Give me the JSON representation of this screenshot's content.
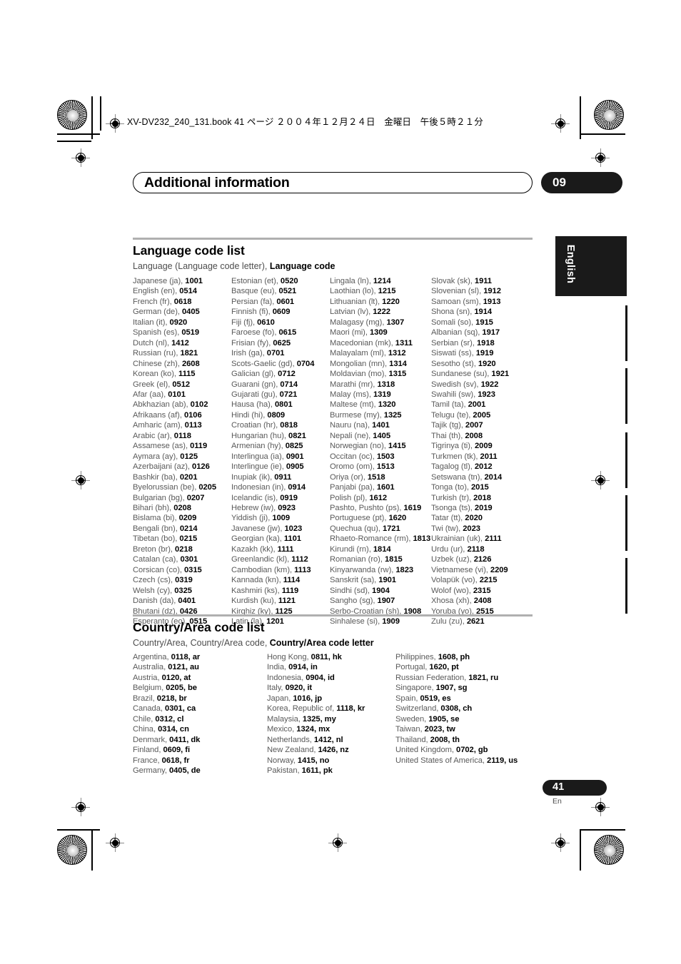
{
  "header": {
    "file_line": "XV-DV232_240_131.book  41 ページ  ２００４年１２月２４日　金曜日　午後５時２１分"
  },
  "chapter": {
    "title": "Additional information",
    "number": "09"
  },
  "side_tab": {
    "label": "English"
  },
  "footer": {
    "page_number": "41",
    "language_mark": "En"
  },
  "language_section": {
    "title": "Language code list",
    "subtitle_plain": "Language (Language code letter), ",
    "subtitle_bold": "Language code",
    "columns": [
      [
        {
          "name": "Japanese (ja), ",
          "code": "1001"
        },
        {
          "name": "English (en), ",
          "code": "0514"
        },
        {
          "name": "French (fr), ",
          "code": "0618"
        },
        {
          "name": "German (de), ",
          "code": "0405"
        },
        {
          "name": "Italian (it), ",
          "code": "0920"
        },
        {
          "name": "Spanish (es), ",
          "code": "0519"
        },
        {
          "name": "Dutch (nl), ",
          "code": "1412"
        },
        {
          "name": "Russian (ru), ",
          "code": "1821"
        },
        {
          "name": "Chinese (zh), ",
          "code": "2608"
        },
        {
          "name": "Korean (ko), ",
          "code": "1115"
        },
        {
          "name": "Greek (el), ",
          "code": "0512"
        },
        {
          "name": "Afar (aa), ",
          "code": "0101"
        },
        {
          "name": "Abkhazian (ab), ",
          "code": "0102"
        },
        {
          "name": "Afrikaans (af), ",
          "code": "0106"
        },
        {
          "name": "Amharic (am), ",
          "code": "0113"
        },
        {
          "name": "Arabic (ar), ",
          "code": "0118"
        },
        {
          "name": "Assamese (as), ",
          "code": "0119"
        },
        {
          "name": "Aymara (ay), ",
          "code": "0125"
        },
        {
          "name": "Azerbaijani (az), ",
          "code": "0126"
        },
        {
          "name": "Bashkir (ba), ",
          "code": "0201"
        },
        {
          "name": "Byelorussian (be), ",
          "code": "0205"
        },
        {
          "name": "Bulgarian (bg), ",
          "code": "0207"
        },
        {
          "name": "Bihari (bh), ",
          "code": "0208"
        },
        {
          "name": "Bislama (bi), ",
          "code": "0209"
        },
        {
          "name": "Bengali (bn), ",
          "code": "0214"
        },
        {
          "name": "Tibetan (bo), ",
          "code": "0215"
        },
        {
          "name": "Breton (br), ",
          "code": "0218"
        },
        {
          "name": "Catalan (ca), ",
          "code": "0301"
        },
        {
          "name": "Corsican (co), ",
          "code": "0315"
        },
        {
          "name": "Czech (cs), ",
          "code": "0319"
        },
        {
          "name": "Welsh (cy), ",
          "code": "0325"
        },
        {
          "name": "Danish (da), ",
          "code": "0401"
        },
        {
          "name": "Bhutani (dz), ",
          "code": "0426"
        },
        {
          "name": "Esperanto (eo), ",
          "code": "0515"
        }
      ],
      [
        {
          "name": "Estonian (et), ",
          "code": "0520"
        },
        {
          "name": "Basque (eu), ",
          "code": "0521"
        },
        {
          "name": "Persian (fa), ",
          "code": "0601"
        },
        {
          "name": "Finnish (fi), ",
          "code": "0609"
        },
        {
          "name": "Fiji (fj), ",
          "code": "0610"
        },
        {
          "name": "Faroese (fo), ",
          "code": "0615"
        },
        {
          "name": "Frisian (fy), ",
          "code": "0625"
        },
        {
          "name": "Irish (ga), ",
          "code": "0701"
        },
        {
          "name": "Scots-Gaelic (gd), ",
          "code": "0704"
        },
        {
          "name": "Galician (gl), ",
          "code": "0712"
        },
        {
          "name": "Guarani (gn), ",
          "code": "0714"
        },
        {
          "name": "Gujarati (gu), ",
          "code": "0721"
        },
        {
          "name": "Hausa (ha), ",
          "code": "0801"
        },
        {
          "name": "Hindi (hi), ",
          "code": "0809"
        },
        {
          "name": "Croatian (hr), ",
          "code": "0818"
        },
        {
          "name": "Hungarian (hu), ",
          "code": "0821"
        },
        {
          "name": "Armenian (hy), ",
          "code": "0825"
        },
        {
          "name": "Interlingua (ia), ",
          "code": "0901"
        },
        {
          "name": "Interlingue (ie), ",
          "code": "0905"
        },
        {
          "name": "Inupiak (ik), ",
          "code": "0911"
        },
        {
          "name": "Indonesian (in), ",
          "code": "0914"
        },
        {
          "name": "Icelandic (is), ",
          "code": "0919"
        },
        {
          "name": "Hebrew (iw), ",
          "code": "0923"
        },
        {
          "name": "Yiddish (ji), ",
          "code": "1009"
        },
        {
          "name": "Javanese (jw), ",
          "code": "1023"
        },
        {
          "name": "Georgian (ka), ",
          "code": "1101"
        },
        {
          "name": "Kazakh (kk), ",
          "code": "1111"
        },
        {
          "name": "Greenlandic  (kl), ",
          "code": "1112"
        },
        {
          "name": "Cambodian (km), ",
          "code": "1113"
        },
        {
          "name": "Kannada (kn), ",
          "code": "1114"
        },
        {
          "name": "Kashmiri (ks), ",
          "code": "1119"
        },
        {
          "name": "Kurdish (ku), ",
          "code": "1121"
        },
        {
          "name": "Kirghiz (ky), ",
          "code": "1125"
        },
        {
          "name": "Latin (la), ",
          "code": "1201"
        }
      ],
      [
        {
          "name": "Lingala (ln), ",
          "code": "1214"
        },
        {
          "name": "Laothian (lo), ",
          "code": "1215"
        },
        {
          "name": "Lithuanian (lt), ",
          "code": "1220"
        },
        {
          "name": "Latvian (lv), ",
          "code": "1222"
        },
        {
          "name": "Malagasy (mg), ",
          "code": "1307"
        },
        {
          "name": "Maori (mi), ",
          "code": "1309"
        },
        {
          "name": "Macedonian (mk), ",
          "code": "1311"
        },
        {
          "name": "Malayalam  (ml), ",
          "code": "1312"
        },
        {
          "name": "Mongolian (mn), ",
          "code": "1314"
        },
        {
          "name": "Moldavian (mo), ",
          "code": "1315"
        },
        {
          "name": "Marathi (mr), ",
          "code": "1318"
        },
        {
          "name": "Malay  (ms), ",
          "code": "1319"
        },
        {
          "name": "Maltese (mt), ",
          "code": "1320"
        },
        {
          "name": "Burmese (my), ",
          "code": "1325"
        },
        {
          "name": "Nauru (na), ",
          "code": "1401"
        },
        {
          "name": "Nepali (ne), ",
          "code": "1405"
        },
        {
          "name": "Norwegian (no), ",
          "code": "1415"
        },
        {
          "name": "Occitan (oc), ",
          "code": "1503"
        },
        {
          "name": "Oromo (om), ",
          "code": "1513"
        },
        {
          "name": "Oriya (or), ",
          "code": "1518"
        },
        {
          "name": "Panjabi (pa), ",
          "code": "1601"
        },
        {
          "name": "Polish (pl), ",
          "code": "1612"
        },
        {
          "name": "Pashto, Pushto (ps), ",
          "code": "1619"
        },
        {
          "name": "Portuguese (pt), ",
          "code": "1620"
        },
        {
          "name": "Quechua (qu), ",
          "code": "1721"
        },
        {
          "name": "Rhaeto-Romance (rm), ",
          "code": "1813"
        },
        {
          "name": "Kirundi (rn), ",
          "code": "1814"
        },
        {
          "name": "Romanian (ro), ",
          "code": "1815"
        },
        {
          "name": "Kinyarwanda (rw), ",
          "code": "1823"
        },
        {
          "name": "Sanskrit (sa), ",
          "code": "1901"
        },
        {
          "name": "Sindhi (sd), ",
          "code": "1904"
        },
        {
          "name": "Sangho (sg), ",
          "code": "1907"
        },
        {
          "name": "Serbo-Croatian (sh), ",
          "code": "1908"
        },
        {
          "name": "Sinhalese (si), ",
          "code": "1909"
        }
      ],
      [
        {
          "name": "Slovak (sk), ",
          "code": "1911"
        },
        {
          "name": "Slovenian (sl), ",
          "code": "1912"
        },
        {
          "name": "Samoan (sm), ",
          "code": "1913"
        },
        {
          "name": "Shona (sn), ",
          "code": "1914"
        },
        {
          "name": "Somali (so), ",
          "code": "1915"
        },
        {
          "name": "Albanian (sq), ",
          "code": "1917"
        },
        {
          "name": "Serbian (sr), ",
          "code": "1918"
        },
        {
          "name": "Siswati (ss), ",
          "code": "1919"
        },
        {
          "name": "Sesotho (st), ",
          "code": "1920"
        },
        {
          "name": "Sundanese (su), ",
          "code": "1921"
        },
        {
          "name": "Swedish (sv), ",
          "code": "1922"
        },
        {
          "name": "Swahili (sw), ",
          "code": "1923"
        },
        {
          "name": "Tamil (ta), ",
          "code": "2001"
        },
        {
          "name": "Telugu (te), ",
          "code": "2005"
        },
        {
          "name": "Tajik (tg), ",
          "code": "2007"
        },
        {
          "name": "Thai (th), ",
          "code": "2008"
        },
        {
          "name": "Tigrinya (ti), ",
          "code": "2009"
        },
        {
          "name": "Turkmen (tk), ",
          "code": "2011"
        },
        {
          "name": "Tagalog (tl), ",
          "code": "2012"
        },
        {
          "name": "Setswana (tn), ",
          "code": "2014"
        },
        {
          "name": "Tonga (to), ",
          "code": "2015"
        },
        {
          "name": "Turkish (tr), ",
          "code": "2018"
        },
        {
          "name": "Tsonga (ts), ",
          "code": "2019"
        },
        {
          "name": "Tatar (tt), ",
          "code": "2020"
        },
        {
          "name": "Twi (tw), ",
          "code": "2023"
        },
        {
          "name": "Ukrainian (uk), ",
          "code": "2111"
        },
        {
          "name": "Urdu (ur), ",
          "code": "2118"
        },
        {
          "name": "Uzbek (uz), ",
          "code": "2126"
        },
        {
          "name": "Vietnamese (vi), ",
          "code": "2209"
        },
        {
          "name": "Volapük (vo), ",
          "code": "2215"
        },
        {
          "name": "Wolof (wo), ",
          "code": "2315"
        },
        {
          "name": "Xhosa (xh), ",
          "code": "2408"
        },
        {
          "name": "Yoruba (yo), ",
          "code": "2515"
        },
        {
          "name": "Zulu (zu), ",
          "code": "2621"
        }
      ]
    ]
  },
  "country_section": {
    "title": "Country/Area code list",
    "subtitle_plain": "Country/Area, Country/Area code, ",
    "subtitle_bold": "Country/Area code letter",
    "columns": [
      [
        {
          "name": "Argentina, ",
          "code": "0118, ar"
        },
        {
          "name": "Australia, ",
          "code": "0121, au"
        },
        {
          "name": "Austria, ",
          "code": "0120, at"
        },
        {
          "name": "Belgium, ",
          "code": "0205, be"
        },
        {
          "name": "Brazil, ",
          "code": "0218, br"
        },
        {
          "name": "Canada, ",
          "code": "0301, ca"
        },
        {
          "name": "Chile, ",
          "code": "0312, cl"
        },
        {
          "name": "China, ",
          "code": "0314, cn"
        },
        {
          "name": "Denmark, ",
          "code": "0411, dk"
        },
        {
          "name": "Finland, ",
          "code": "0609, fi"
        },
        {
          "name": "France, ",
          "code": "0618, fr"
        },
        {
          "name": "Germany, ",
          "code": "0405, de"
        }
      ],
      [
        {
          "name": "Hong Kong, ",
          "code": "0811, hk"
        },
        {
          "name": "India, ",
          "code": "0914, in"
        },
        {
          "name": "Indonesia, ",
          "code": "0904, id"
        },
        {
          "name": "Italy, ",
          "code": "0920, it"
        },
        {
          "name": "Japan, ",
          "code": "1016, jp"
        },
        {
          "name": "Korea, Republic of, ",
          "code": "1118, kr"
        },
        {
          "name": "Malaysia, ",
          "code": "1325, my"
        },
        {
          "name": "Mexico, ",
          "code": "1324, mx"
        },
        {
          "name": "Netherlands, ",
          "code": "1412, nl"
        },
        {
          "name": "New Zealand, ",
          "code": "1426, nz"
        },
        {
          "name": "Norway, ",
          "code": "1415, no"
        },
        {
          "name": "Pakistan, ",
          "code": "1611, pk"
        }
      ],
      [
        {
          "name": "Philippines, ",
          "code": "1608, ph"
        },
        {
          "name": "Portugal, ",
          "code": "1620, pt"
        },
        {
          "name": "Russian Federation, ",
          "code": "1821, ru"
        },
        {
          "name": "Singapore, ",
          "code": "1907, sg"
        },
        {
          "name": "Spain, ",
          "code": "0519, es"
        },
        {
          "name": "Switzerland, ",
          "code": "0308, ch"
        },
        {
          "name": "Sweden, ",
          "code": "1905, se"
        },
        {
          "name": "Taiwan, ",
          "code": "2023, tw"
        },
        {
          "name": "Thailand, ",
          "code": "2008, th"
        },
        {
          "name": "United Kingdom, ",
          "code": "0702, gb"
        },
        {
          "name": "United States of America, ",
          "code": "2119, us"
        }
      ]
    ]
  }
}
